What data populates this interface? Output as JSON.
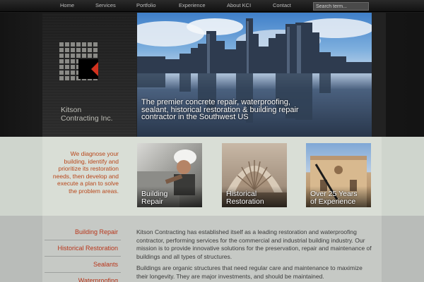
{
  "nav": {
    "items": [
      "Home",
      "Services",
      "Portfolio",
      "Experience",
      "About KCI",
      "Contact"
    ],
    "search_placeholder": "Search term..."
  },
  "brand": {
    "name": "Kitson Contracting Inc.",
    "name_line1": "Kitson",
    "name_line2": "Contracting Inc.",
    "accent": "#d2321e"
  },
  "hero": {
    "caption": "The premier concrete repair, waterproofing, sealant, historical restoration & building repair contractor in the Southwest US"
  },
  "intro": {
    "text": "We diagnose your building, identify and prioritize its restoration needs, then develop and execute a plan to solve the problem areas."
  },
  "cards": [
    {
      "line1": "Building",
      "line2": "Repair"
    },
    {
      "line1": "Historical",
      "line2": "Restoration"
    },
    {
      "line1": "Over 25 Years",
      "line2": "of Experience"
    }
  ],
  "sidebar": {
    "items": [
      "Building Repair",
      "Historical Restoration",
      "Sealants",
      "Waterproofing"
    ]
  },
  "body": {
    "p1": "Kitson Contracting has established itself as a leading restoration and waterproofing contractor, performing services for the commercial and industrial building industry. Our mission is to provide innovative solutions for the preservation, repair and maintenance of buildings and all types of structures.",
    "p2": "Buildings are organic structures that need regular care and maintenance to maximize their longevity. They are major investments, and should be maintained."
  },
  "colors": {
    "accent_text": "#b8471b",
    "link_red": "#b8351a",
    "band": "#d9ded6",
    "lower": "#c6c9c5"
  }
}
